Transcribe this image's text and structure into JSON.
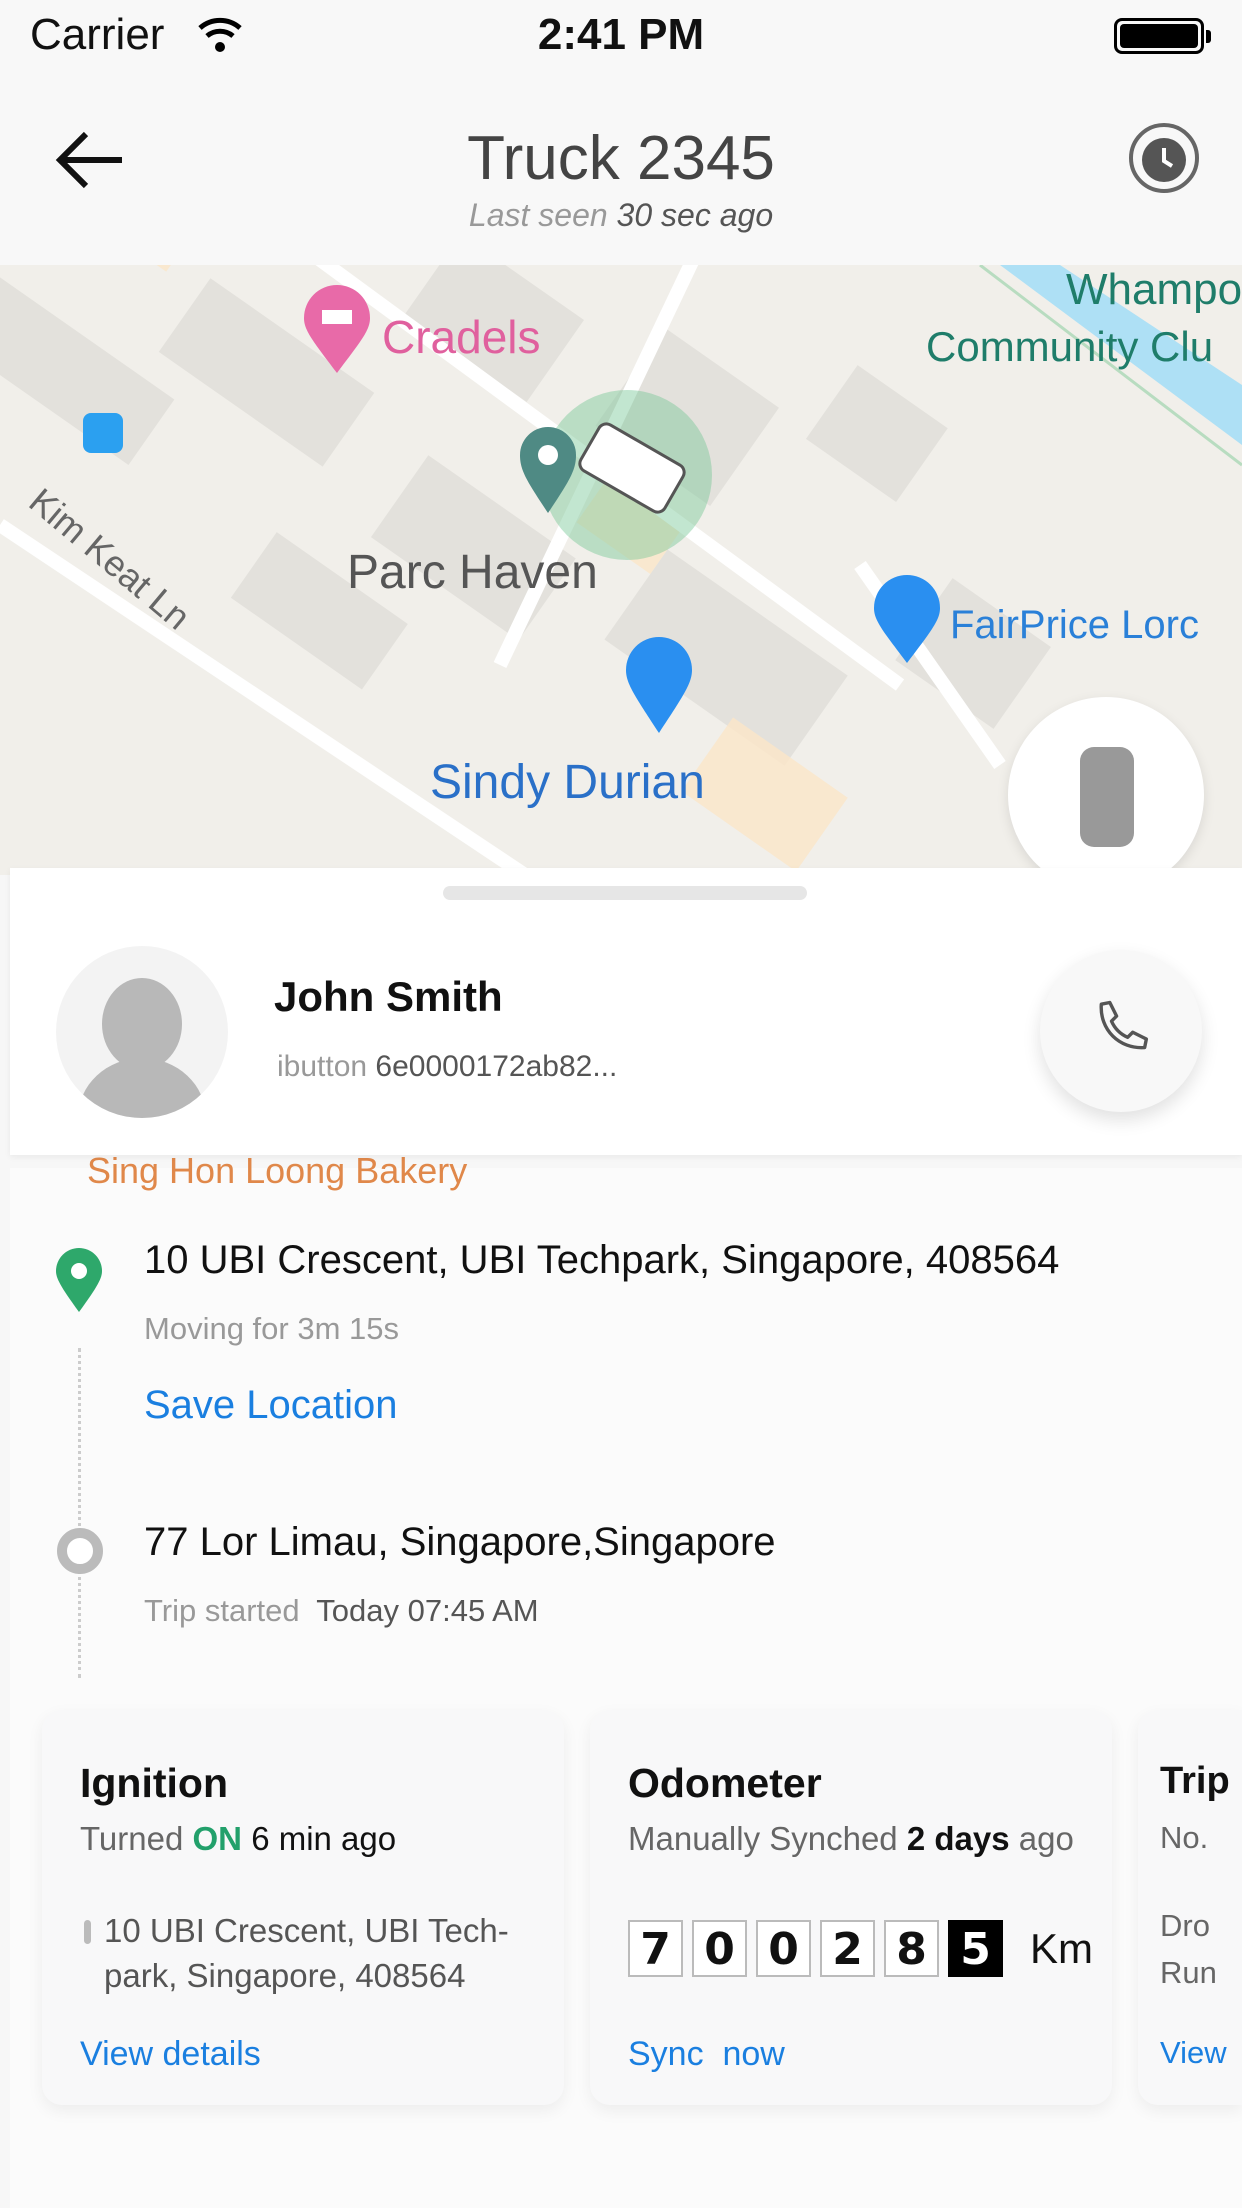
{
  "status_bar": {
    "carrier": "Carrier",
    "time": "2:41 PM"
  },
  "header": {
    "title": "Truck 2345",
    "last_seen_label": "Last seen",
    "last_seen_value": "30 sec ago"
  },
  "map": {
    "labels": {
      "cradels": "Cradels",
      "whampoa": "Whampo",
      "community": "Community Clu",
      "parc_haven": "Parc Haven",
      "kim_keat": "Kim Keat Ln",
      "fairprice": "FairPrice Lorc",
      "sindy": "Sindy Durian",
      "bakery": "Sing Hon Loong Bakery"
    }
  },
  "driver": {
    "name": "John Smith",
    "ibutton_label": "ibutton",
    "ibutton_value": "6e0000172ab82..."
  },
  "trip": {
    "current_address": "10 UBI Crescent, UBI Techpark, Singapore, 408564",
    "moving_for": "Moving for 3m 15s",
    "save_location": "Save Location",
    "start_address": "77 Lor Limau, Singapore,Singapore",
    "trip_started_label": "Trip started",
    "trip_started_value": "Today 07:45 AM"
  },
  "cards": {
    "ignition": {
      "title": "Ignition",
      "pre": "Turned",
      "state": "ON",
      "post": "6 min ago",
      "address": "10 UBI Crescent, UBI Tech-park, Singapore, 408564",
      "link": "View details"
    },
    "odometer": {
      "title": "Odometer",
      "pre": "Manually Synched",
      "bold": "2 days",
      "post": "ago",
      "digits": [
        "7",
        "0",
        "0",
        "2",
        "8",
        "5"
      ],
      "unit": "Km",
      "link": "Sync  now"
    },
    "trip": {
      "title": "Trip",
      "line1": "No.",
      "line2": "Dro",
      "line3": "Run",
      "link": "View"
    }
  },
  "colors": {
    "accent": "#1a7fe0",
    "on": "#22a06b",
    "pin": "#2ea86b"
  }
}
